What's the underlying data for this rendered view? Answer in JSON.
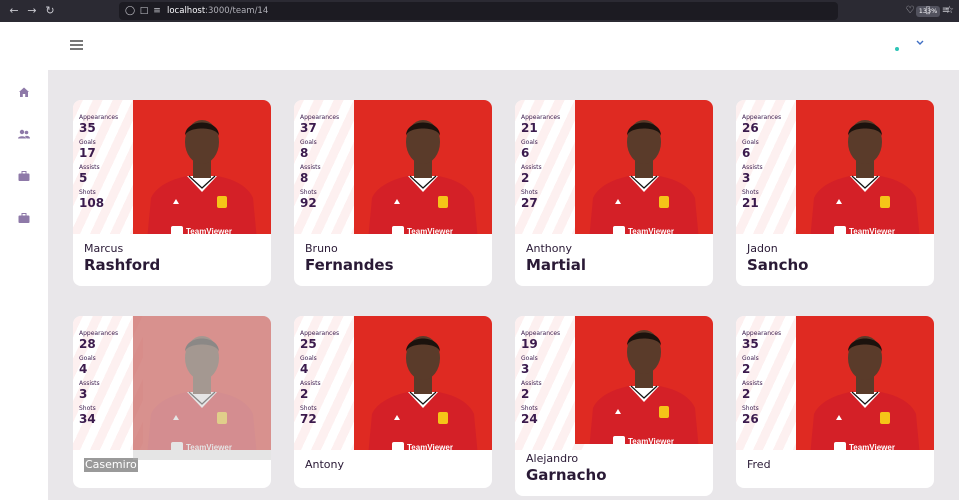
{
  "browser": {
    "url_host": "localhost",
    "url_path": ":3000/team/14",
    "zoom": "133%"
  },
  "players": [
    {
      "first_name": "Marcus",
      "last_name": "Rashford",
      "appearances": "35",
      "goals": "17",
      "assists": "5",
      "shots": "108"
    },
    {
      "first_name": "Bruno",
      "last_name": "Fernandes",
      "appearances": "37",
      "goals": "8",
      "assists": "8",
      "shots": "92"
    },
    {
      "first_name": "Anthony",
      "last_name": "Martial",
      "appearances": "21",
      "goals": "6",
      "assists": "2",
      "shots": "27"
    },
    {
      "first_name": "Jadon",
      "last_name": "Sancho",
      "appearances": "26",
      "goals": "6",
      "assists": "3",
      "shots": "21"
    },
    {
      "first_name": "Casemiro",
      "last_name": "",
      "appearances": "28",
      "goals": "4",
      "assists": "3",
      "shots": "34"
    },
    {
      "first_name": "Antony",
      "last_name": "",
      "appearances": "25",
      "goals": "4",
      "assists": "2",
      "shots": "72"
    },
    {
      "first_name": "Alejandro",
      "last_name": "Garnacho",
      "appearances": "19",
      "goals": "3",
      "assists": "2",
      "shots": "24"
    },
    {
      "first_name": "Fred",
      "last_name": "",
      "appearances": "35",
      "goals": "2",
      "assists": "2",
      "shots": "26"
    }
  ],
  "labels": {
    "appearances": "Appearances",
    "goals": "Goals",
    "assists": "Assists",
    "shots": "Shots",
    "sponsor": "TeamViewer"
  },
  "icons": {
    "sidebar": [
      "home-icon",
      "users-icon",
      "briefcase-icon",
      "briefcase-icon"
    ]
  },
  "colors": {
    "brand_red": "#df2a22",
    "accent_purple": "#3b1b4d",
    "status_teal": "#2ec4b6"
  }
}
